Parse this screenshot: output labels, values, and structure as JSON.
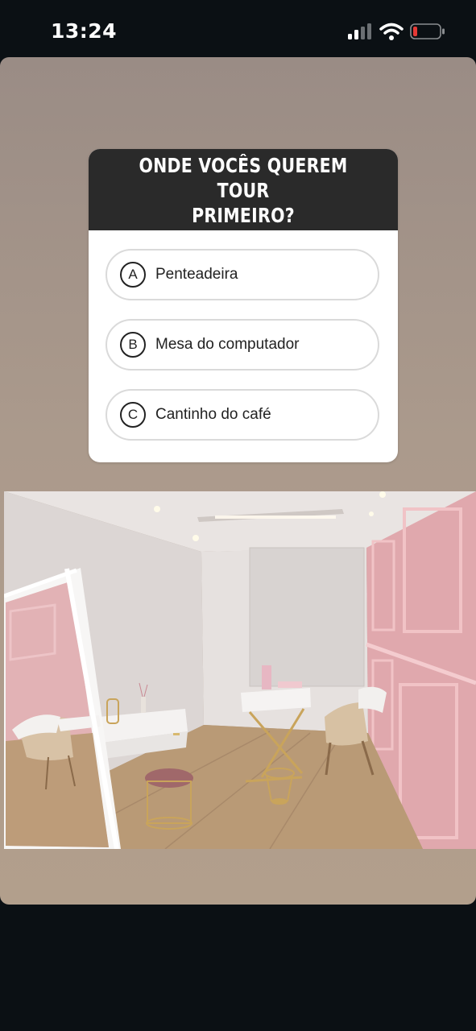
{
  "status_bar": {
    "time": "13:24",
    "signal_icon": "cellular-signal-icon",
    "wifi_icon": "wifi-icon",
    "battery_icon": "battery-low-icon",
    "battery_color": "#e53935"
  },
  "quiz": {
    "question": "ONDE VOCÊS QUEREM TOUR\nPRIMEIRO?",
    "options": [
      {
        "letter": "A",
        "label": "Penteadeira"
      },
      {
        "letter": "B",
        "label": "Mesa do computador"
      },
      {
        "letter": "C",
        "label": "Cantinho do café"
      }
    ]
  },
  "photo": {
    "subject": "room-interior-photo"
  }
}
